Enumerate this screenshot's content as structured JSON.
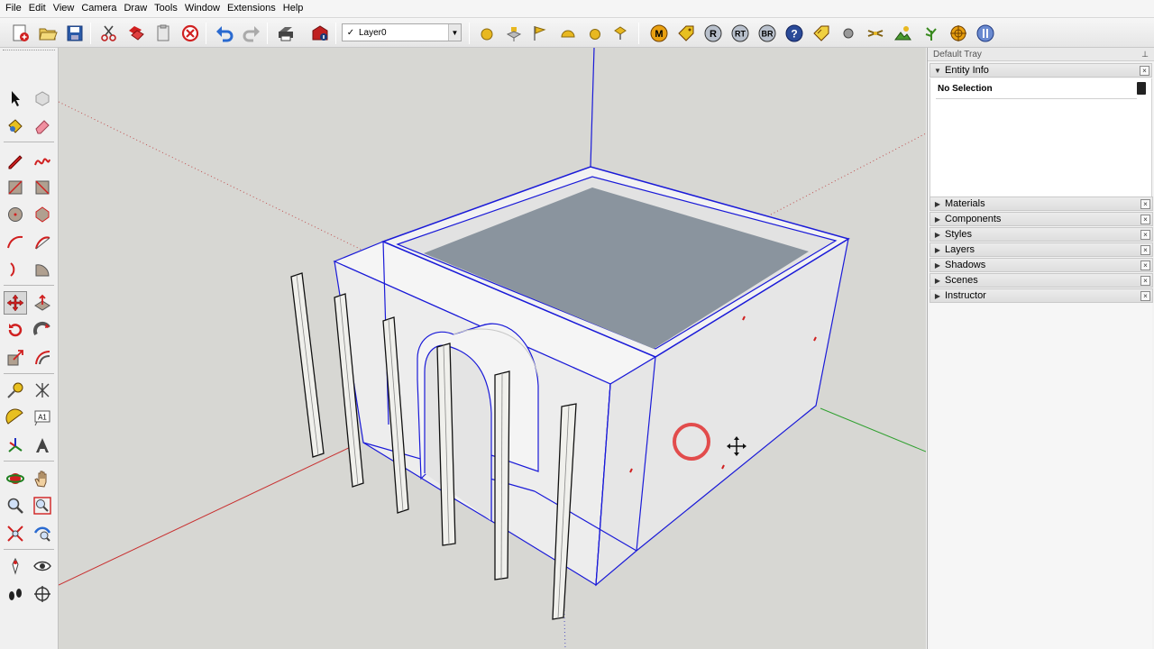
{
  "menu": [
    "File",
    "Edit",
    "View",
    "Camera",
    "Draw",
    "Tools",
    "Window",
    "Extensions",
    "Help"
  ],
  "layer": {
    "current": "Layer0",
    "check": "✓"
  },
  "toolbar_badges": {
    "m": "M",
    "r": "R",
    "rt": "RT",
    "br": "BR",
    "help": "?"
  },
  "tray": {
    "title": "Default Tray",
    "entity_info": {
      "label": "Entity Info",
      "selection": "No Selection"
    },
    "panels": [
      "Materials",
      "Components",
      "Styles",
      "Layers",
      "Shadows",
      "Scenes",
      "Instructor"
    ]
  },
  "palette_text": {
    "text_tool": "A1"
  },
  "colors": {
    "viewport_bg": "#d7d7d3",
    "selection_blue": "#1a1ad8",
    "axis_red": "#cc3030",
    "axis_green": "#30a030",
    "roof_fill": "#8a949e",
    "wall_face": "#ececec",
    "cursor_ring": "#e03030"
  }
}
